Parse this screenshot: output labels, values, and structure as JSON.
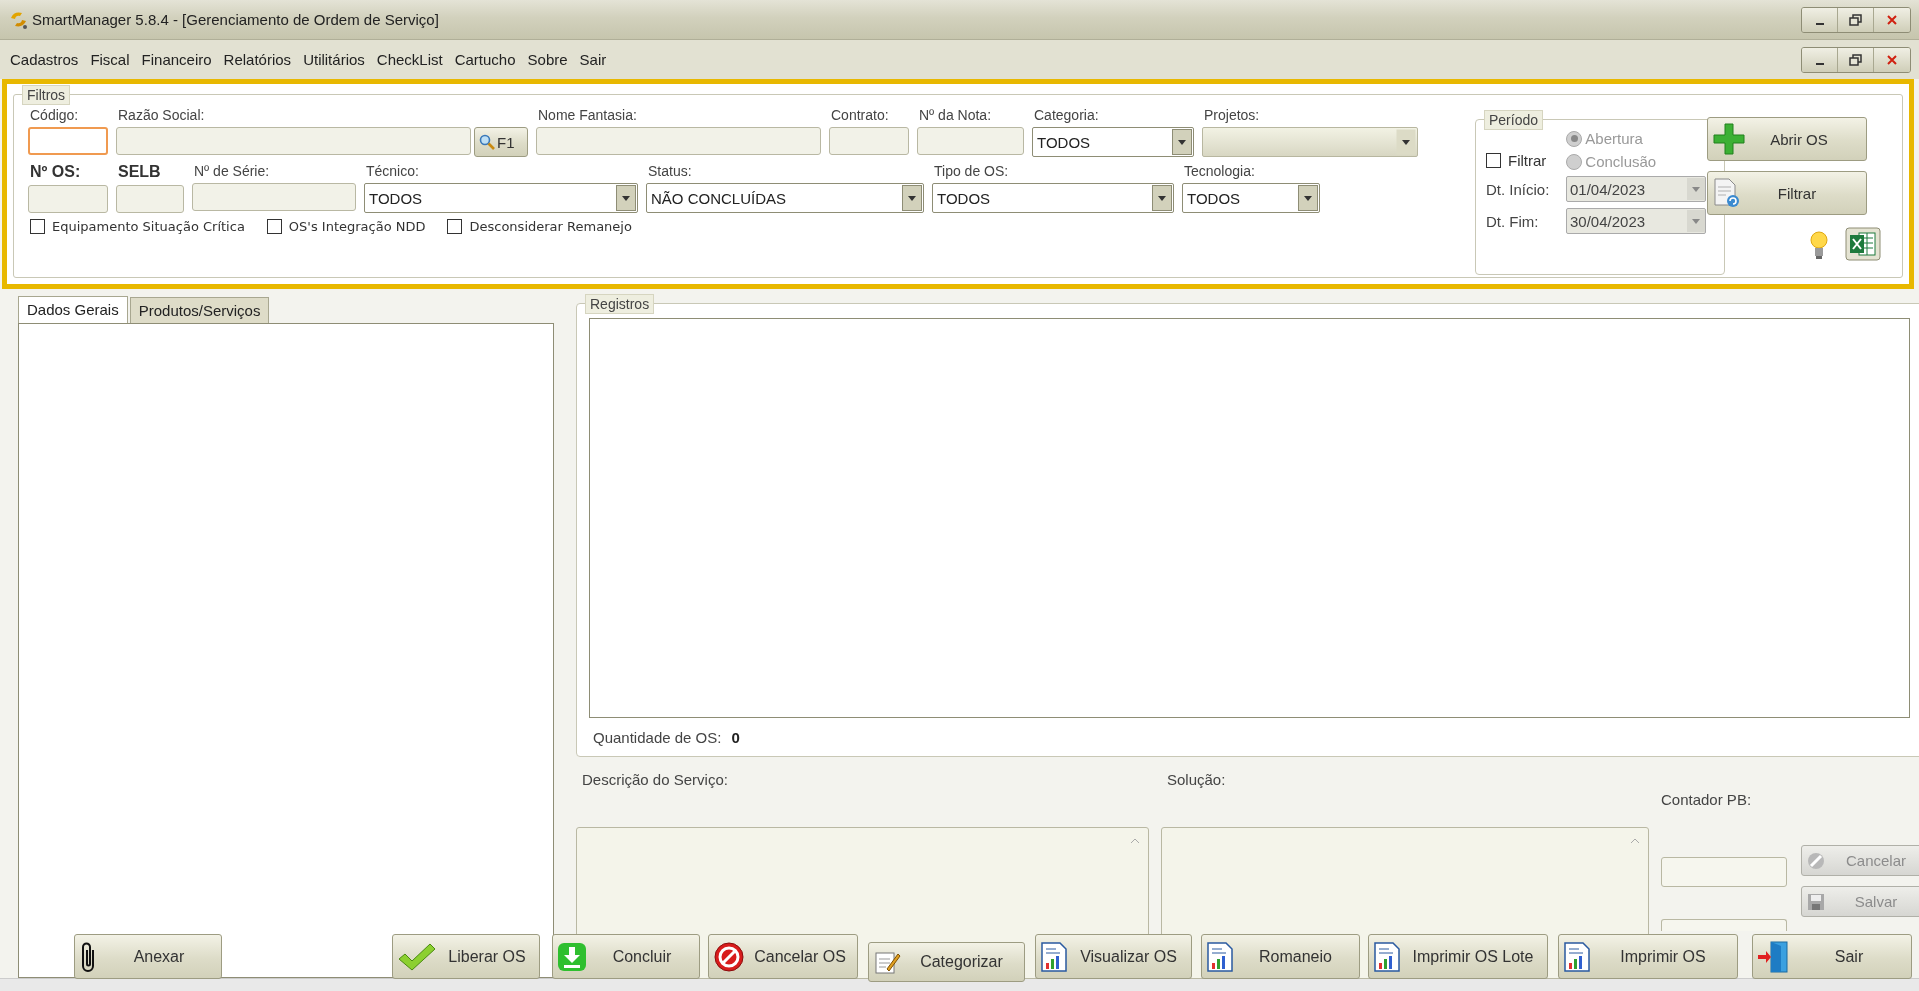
{
  "window": {
    "title": "SmartManager 5.8.4 - [Gerenciamento de Ordem de Serviço]"
  },
  "menu": [
    "Cadastros",
    "Fiscal",
    "Financeiro",
    "Relatórios",
    "Utilitários",
    "CheckList",
    "Cartucho",
    "Sobre",
    "Sair"
  ],
  "filters": {
    "title": "Filtros",
    "row1": [
      {
        "kind": "text",
        "label": "Código:",
        "bold": false,
        "focused": true,
        "disabled": false
      },
      {
        "kind": "lookup",
        "label": "Razão Social:",
        "bold": false,
        "focused": false,
        "disabled": false,
        "button": "F1"
      },
      {
        "kind": "text",
        "label": "Nome Fantasia:",
        "bold": false,
        "focused": false,
        "disabled": false
      },
      {
        "kind": "text",
        "label": "Contrato:",
        "bold": false,
        "focused": false,
        "disabled": false
      },
      {
        "kind": "text",
        "label": "Nº da Nota:",
        "bold": false,
        "focused": false,
        "disabled": false
      },
      {
        "kind": "dropdown",
        "label": "Categoria:",
        "bold": false,
        "focused": false,
        "disabled": false,
        "value": "TODOS"
      },
      {
        "kind": "dropdown",
        "label": "Projetos:",
        "bold": false,
        "focused": false,
        "disabled": true
      }
    ],
    "row2": [
      {
        "kind": "text",
        "label": "Nº OS:",
        "bold": true,
        "focused": false,
        "disabled": false
      },
      {
        "kind": "text",
        "label": "SELB",
        "bold": true,
        "focused": false,
        "disabled": false
      },
      {
        "kind": "text",
        "label": "Nº de Série:",
        "bold": false,
        "focused": false,
        "disabled": false
      },
      {
        "kind": "dropdown",
        "label": "Técnico:",
        "bold": false,
        "focused": false,
        "disabled": false,
        "value": "TODOS"
      },
      {
        "kind": "dropdown",
        "label": "Status:",
        "bold": false,
        "focused": false,
        "disabled": false,
        "value": "NÃO CONCLUÍDAS"
      },
      {
        "kind": "dropdown",
        "label": "Tipo de OS:",
        "bold": false,
        "focused": false,
        "disabled": false,
        "value": "TODOS"
      },
      {
        "kind": "dropdown",
        "label": "Tecnologia:",
        "bold": false,
        "focused": false,
        "disabled": false,
        "value": "TODOS"
      }
    ],
    "checkboxes": [
      {
        "label": "Equipamento Situação Crítica",
        "checked": false
      },
      {
        "label": "OS's Integração NDD",
        "checked": false
      },
      {
        "label": "Desconsiderar Remanejo",
        "checked": false
      }
    ]
  },
  "period": {
    "title": "Período",
    "disabled": true,
    "filter": {
      "label": "Filtrar",
      "checked": false
    },
    "options": [
      {
        "label": "Abertura",
        "selected": true
      },
      {
        "label": "Conclusão",
        "selected": false
      }
    ],
    "start": {
      "label": "Dt. Início:",
      "value": "01/04/2023"
    },
    "end": {
      "label": "Dt. Fim:",
      "value": "30/04/2023"
    }
  },
  "actions": [
    {
      "label": "Abrir OS",
      "kind": "add"
    },
    {
      "label": "Filtrar",
      "kind": "refresh"
    }
  ],
  "tabs": [
    {
      "label": "Dados Gerais",
      "selected": true
    },
    {
      "label": "Produtos/Serviços",
      "selected": false
    }
  ],
  "records": {
    "title": "Registros",
    "count_label": "Quantidade de OS:",
    "count": "0"
  },
  "details": {
    "description_label": "Descrição do Serviço:",
    "solution_label": "Solução:",
    "counter_label": "Contador PB:",
    "buttons": [
      {
        "label": "Cancelar",
        "kind": "cancel",
        "disabled": true
      },
      {
        "label": "Salvar",
        "kind": "save",
        "disabled": true
      }
    ]
  },
  "toolbar": [
    {
      "label": "Anexar",
      "kind": "attach"
    },
    {
      "label": "Liberar OS",
      "kind": "approve"
    },
    {
      "label": "Concluir",
      "kind": "finish"
    },
    {
      "label": "Cancelar OS",
      "kind": "cancel"
    },
    {
      "label": "Categorizar",
      "kind": "categorize"
    },
    {
      "label": "Visualizar OS",
      "kind": "report"
    },
    {
      "label": "Romaneio",
      "kind": "report"
    },
    {
      "label": "Imprimir OS Lote",
      "kind": "report"
    },
    {
      "label": "Imprimir OS",
      "kind": "report"
    },
    {
      "label": "Sair",
      "kind": "exit"
    }
  ]
}
